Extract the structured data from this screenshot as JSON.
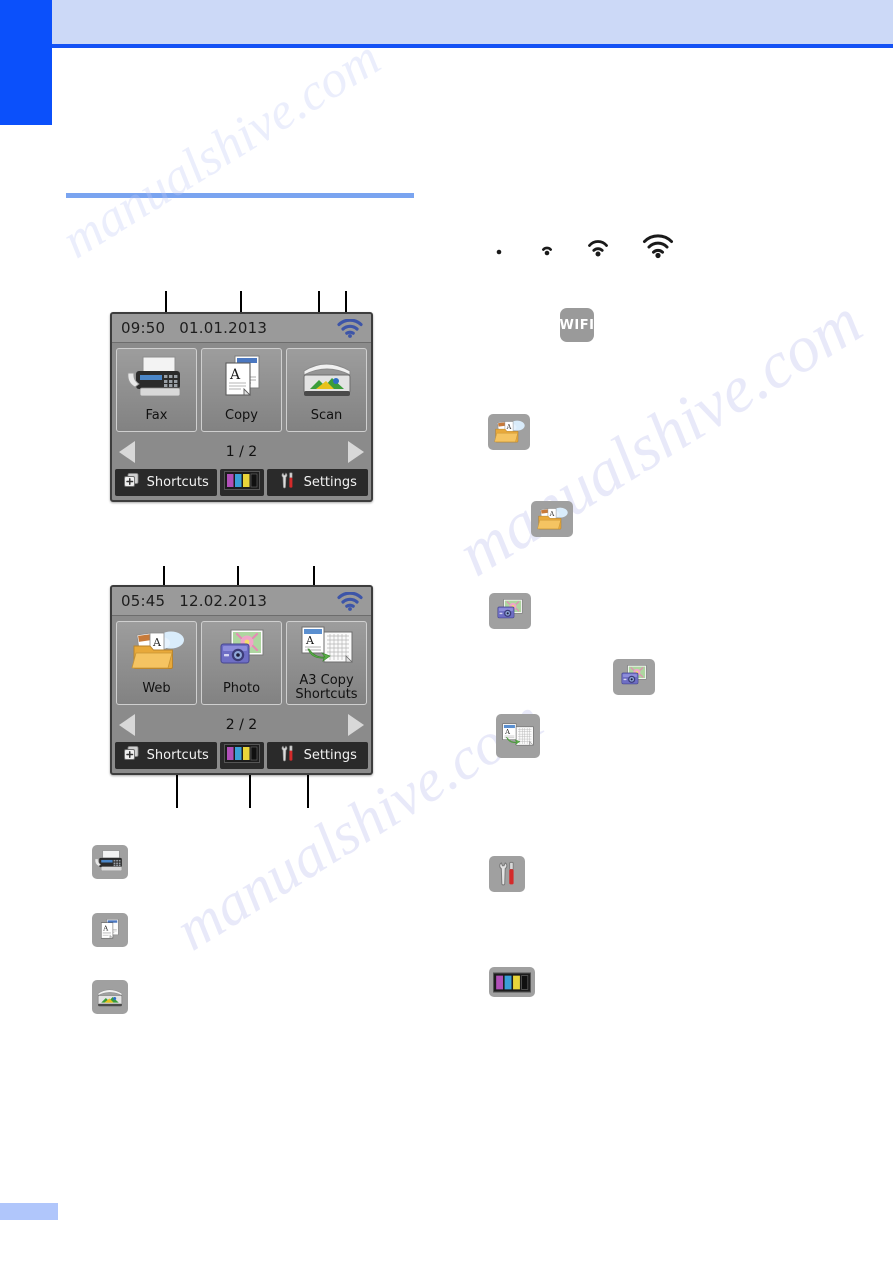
{
  "page": {
    "tab_color": "#0b50fb",
    "header_band_color": "#ccd9f7",
    "header_rule_color": "#1452f5",
    "section_rule_color": "#7aa4f0",
    "watermark_text": "manualshive.com"
  },
  "lcd_screens": [
    {
      "id": "home-screen-1",
      "time": "09:50",
      "date": "01.01.2013",
      "wifi_icon": "wifi-full-icon",
      "page_indicator": "1 / 2",
      "apps": [
        {
          "label": "Fax",
          "icon": "fax-icon"
        },
        {
          "label": "Copy",
          "icon": "copy-icon"
        },
        {
          "label": "Scan",
          "icon": "scan-icon"
        }
      ],
      "bottom_bar": {
        "shortcuts_label": "Shortcuts",
        "shortcuts_icon": "shortcuts-plus-icon",
        "ink_icon": "ink-cartridges-icon",
        "settings_label": "Settings",
        "settings_icon": "tools-icon"
      },
      "prev_arrow": "arrow-left-icon",
      "next_arrow": "arrow-right-icon"
    },
    {
      "id": "home-screen-2",
      "time": "05:45",
      "date": "12.02.2013",
      "wifi_icon": "wifi-full-icon",
      "page_indicator": "2 / 2",
      "apps": [
        {
          "label": "Web",
          "icon": "web-cloud-folder-icon"
        },
        {
          "label": "Photo",
          "icon": "photo-camera-icon"
        },
        {
          "label": "A3 Copy\nShortcuts",
          "label_line1": "A3 Copy",
          "label_line2": "Shortcuts",
          "icon": "a3-copy-shortcuts-icon"
        }
      ],
      "bottom_bar": {
        "shortcuts_label": "Shortcuts",
        "shortcuts_icon": "shortcuts-plus-icon",
        "ink_icon": "ink-cartridges-icon",
        "settings_label": "Settings",
        "settings_icon": "tools-icon"
      },
      "prev_arrow": "arrow-left-icon",
      "next_arrow": "arrow-right-icon"
    }
  ],
  "wireless_status_icons": [
    {
      "name": "wifi-0-bars-icon",
      "bars": 0
    },
    {
      "name": "wifi-1-bar-icon",
      "bars": 1
    },
    {
      "name": "wifi-2-bars-icon",
      "bars": 2
    },
    {
      "name": "wifi-3-bars-icon",
      "bars": 3
    }
  ],
  "wifi_button": {
    "label": "WIFI",
    "name": "wifi-setup-button"
  },
  "legend_left": [
    {
      "name": "fax-icon"
    },
    {
      "name": "copy-icon"
    },
    {
      "name": "scan-icon"
    }
  ],
  "legend_right": [
    {
      "name": "web-cloud-folder-icon"
    },
    {
      "name": "web-cloud-folder-icon-indented"
    },
    {
      "name": "photo-camera-icon"
    },
    {
      "name": "photo-camera-icon-indented"
    },
    {
      "name": "a3-copy-shortcuts-icon"
    },
    {
      "name": "tools-icon"
    },
    {
      "name": "ink-cartridges-icon"
    }
  ],
  "colors": {
    "ink_magenta": "#b14fb8",
    "ink_cyan": "#3a9fd8",
    "ink_yellow": "#e8d53a",
    "ink_black": "#1a1a1a",
    "lcd_body": "#8b8b8b",
    "lcd_status": "#9a9a9a",
    "lcd_bottom_bar": "#2a2a2a",
    "wifi_blue": "#3d55a8"
  }
}
